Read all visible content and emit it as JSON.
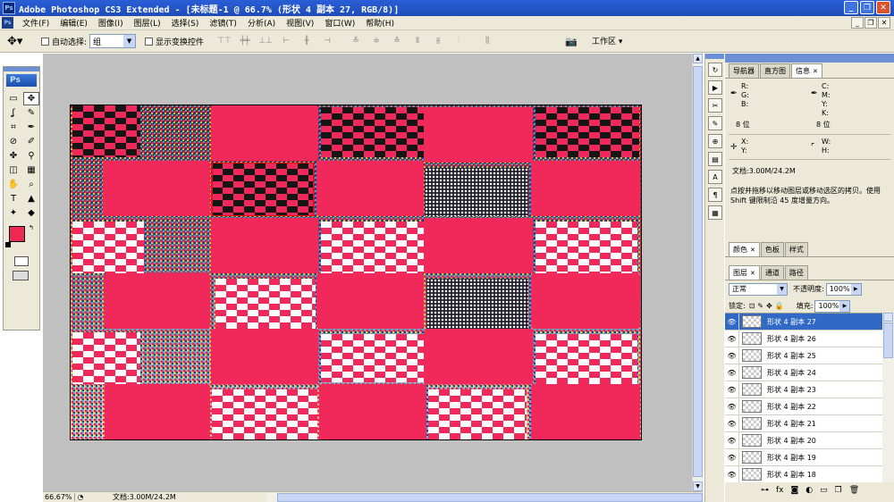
{
  "window": {
    "title": "Adobe Photoshop CS3 Extended - [未标题-1 @ 66.7% (形状 4 副本 27, RGB/8)]",
    "app_badge": "Ps"
  },
  "menu": [
    "文件(F)",
    "编辑(E)",
    "图像(I)",
    "图层(L)",
    "选择(S)",
    "滤镜(T)",
    "分析(A)",
    "视图(V)",
    "窗口(W)",
    "帮助(H)"
  ],
  "options": {
    "auto_select_label": "自动选择:",
    "auto_select_value": "组",
    "show_transform_label": "显示变换控件",
    "workspace_label": "工作区 ▾"
  },
  "toolbox": {
    "logo": "Ps",
    "tools": [
      "▭",
      "✥",
      "ʆ",
      "✎",
      "⌗",
      "✒",
      "⊘",
      "✐",
      "✤",
      "⚲",
      "◫",
      "▦",
      "✋",
      "⌕",
      "T",
      "▲",
      "✦",
      "◆"
    ],
    "foreground_color": "#ed2a53",
    "background_color": "#ffffff"
  },
  "status": {
    "zoom": "66.67%",
    "doc": "文档:3.00M/24.2M"
  },
  "panels": {
    "top_tabs": [
      {
        "label": "导航器",
        "active": false
      },
      {
        "label": "直方图",
        "active": false
      },
      {
        "label": "信息",
        "active": true
      }
    ],
    "info": {
      "rgb": [
        "R:",
        "G:",
        "B:"
      ],
      "cmyk": [
        "C:",
        "M:",
        "Y:",
        "K:"
      ],
      "bit_left": "8 位",
      "bit_right": "8 位",
      "xy": [
        "X:",
        "Y:"
      ],
      "wh": [
        "W:",
        "H:"
      ],
      "doc": "文档:3.00M/24.2M",
      "help": "点按并拖移以移动图层或移动选区的拷贝。使用 Shift 键限制沿 45 度增量方向。"
    },
    "color_tabs": [
      {
        "label": "颜色",
        "active": true
      },
      {
        "label": "色板",
        "active": false
      },
      {
        "label": "样式",
        "active": false
      }
    ],
    "layer_tabs": [
      {
        "label": "图层",
        "active": true
      },
      {
        "label": "通道",
        "active": false
      },
      {
        "label": "路径",
        "active": false
      }
    ],
    "blend_mode": "正常",
    "opacity_label": "不透明度:",
    "opacity_value": "100%",
    "lock_label": "锁定:",
    "fill_label": "填充:",
    "fill_value": "100%",
    "layers": [
      {
        "name": "形状 4 副本 27",
        "selected": true
      },
      {
        "name": "形状 4 副本 26",
        "selected": false
      },
      {
        "name": "形状 4 副本 25",
        "selected": false
      },
      {
        "name": "形状 4 副本 24",
        "selected": false
      },
      {
        "name": "形状 4 副本 23",
        "selected": false
      },
      {
        "name": "形状 4 副本 22",
        "selected": false
      },
      {
        "name": "形状 4 副本 21",
        "selected": false
      },
      {
        "name": "形状 4 副本 20",
        "selected": false
      },
      {
        "name": "形状 4 副本 19",
        "selected": false
      },
      {
        "name": "形状 4 副本 18",
        "selected": false
      }
    ]
  },
  "colors": {
    "pink": "#f1295a",
    "selection": "#3169c6"
  }
}
